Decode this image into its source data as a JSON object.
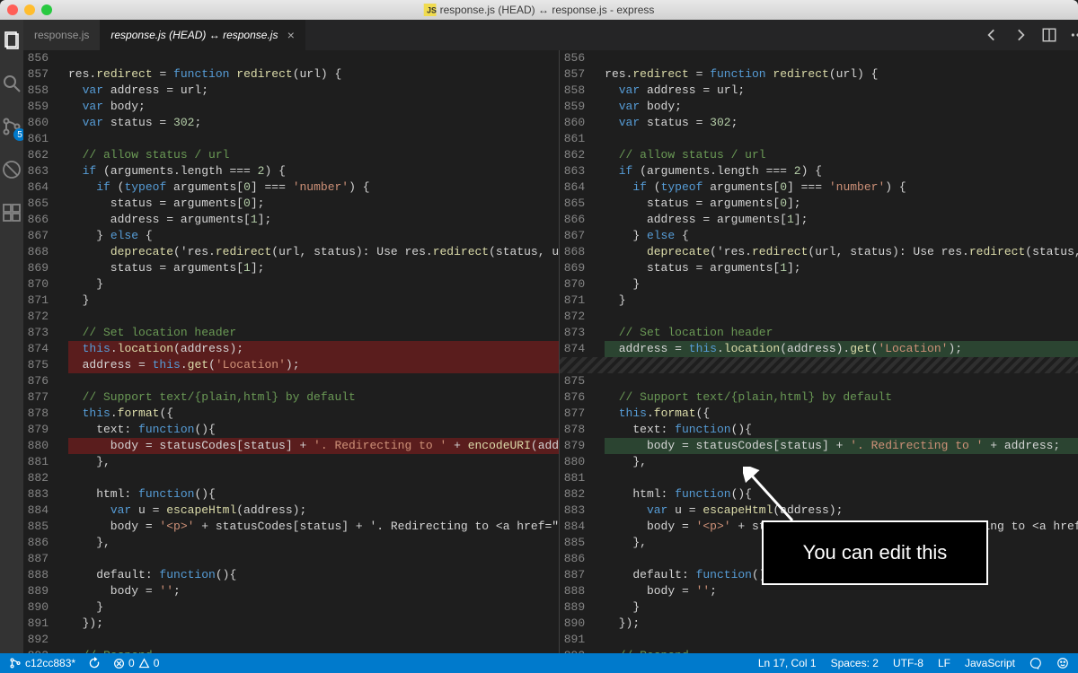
{
  "window": {
    "title": "response.js (HEAD) ↔ response.js - express"
  },
  "activity_bar": {
    "scm_badge": "5"
  },
  "tabs": [
    {
      "label": "response.js",
      "active": false
    },
    {
      "label": "response.js (HEAD) ↔ response.js",
      "active": true
    }
  ],
  "diff": {
    "left_start": 856,
    "right_start": 856,
    "left_lines": [
      {
        "n": 856,
        "t": "",
        "c": ""
      },
      {
        "n": 857,
        "t": "res.redirect = function redirect(url) {",
        "c": ""
      },
      {
        "n": 858,
        "t": "  var address = url;",
        "c": ""
      },
      {
        "n": 859,
        "t": "  var body;",
        "c": ""
      },
      {
        "n": 860,
        "t": "  var status = 302;",
        "c": ""
      },
      {
        "n": 861,
        "t": "",
        "c": ""
      },
      {
        "n": 862,
        "t": "  // allow status / url",
        "c": "cm"
      },
      {
        "n": 863,
        "t": "  if (arguments.length === 2) {",
        "c": ""
      },
      {
        "n": 864,
        "t": "    if (typeof arguments[0] === 'number') {",
        "c": ""
      },
      {
        "n": 865,
        "t": "      status = arguments[0];",
        "c": ""
      },
      {
        "n": 866,
        "t": "      address = arguments[1];",
        "c": ""
      },
      {
        "n": 867,
        "t": "    } else {",
        "c": ""
      },
      {
        "n": 868,
        "t": "      deprecate('res.redirect(url, status): Use res.redirect(status, u",
        "c": ""
      },
      {
        "n": 869,
        "t": "      status = arguments[1];",
        "c": ""
      },
      {
        "n": 870,
        "t": "    }",
        "c": ""
      },
      {
        "n": 871,
        "t": "  }",
        "c": ""
      },
      {
        "n": 872,
        "t": "",
        "c": ""
      },
      {
        "n": 873,
        "t": "  // Set location header",
        "c": "cm"
      },
      {
        "n": 874,
        "t": "  this.location(address);",
        "c": "",
        "m": "del"
      },
      {
        "n": 875,
        "t": "  address = this.get('Location');",
        "c": "",
        "m": "del"
      },
      {
        "n": 876,
        "t": "",
        "c": ""
      },
      {
        "n": 877,
        "t": "  // Support text/{plain,html} by default",
        "c": "cm"
      },
      {
        "n": 878,
        "t": "  this.format({",
        "c": ""
      },
      {
        "n": 879,
        "t": "    text: function(){",
        "c": ""
      },
      {
        "n": 880,
        "t": "      body = statusCodes[status] + '. Redirecting to ' + encodeURI(add",
        "c": "",
        "m": "del"
      },
      {
        "n": 881,
        "t": "    },",
        "c": ""
      },
      {
        "n": 882,
        "t": "",
        "c": ""
      },
      {
        "n": 883,
        "t": "    html: function(){",
        "c": ""
      },
      {
        "n": 884,
        "t": "      var u = escapeHtml(address);",
        "c": ""
      },
      {
        "n": 885,
        "t": "      body = '<p>' + statusCodes[status] + '. Redirecting to <a href=\"",
        "c": ""
      },
      {
        "n": 886,
        "t": "    },",
        "c": ""
      },
      {
        "n": 887,
        "t": "",
        "c": ""
      },
      {
        "n": 888,
        "t": "    default: function(){",
        "c": ""
      },
      {
        "n": 889,
        "t": "      body = '';",
        "c": ""
      },
      {
        "n": 890,
        "t": "    }",
        "c": ""
      },
      {
        "n": 891,
        "t": "  });",
        "c": ""
      },
      {
        "n": 892,
        "t": "",
        "c": ""
      },
      {
        "n": 893,
        "t": "  // Respond",
        "c": "cm"
      }
    ],
    "right_lines": [
      {
        "n": 856,
        "t": "",
        "c": ""
      },
      {
        "n": 857,
        "t": "res.redirect = function redirect(url) {",
        "c": ""
      },
      {
        "n": 858,
        "t": "  var address = url;",
        "c": ""
      },
      {
        "n": 859,
        "t": "  var body;",
        "c": ""
      },
      {
        "n": 860,
        "t": "  var status = 302;",
        "c": ""
      },
      {
        "n": 861,
        "t": "",
        "c": ""
      },
      {
        "n": 862,
        "t": "  // allow status / url",
        "c": "cm"
      },
      {
        "n": 863,
        "t": "  if (arguments.length === 2) {",
        "c": ""
      },
      {
        "n": 864,
        "t": "    if (typeof arguments[0] === 'number') {",
        "c": ""
      },
      {
        "n": 865,
        "t": "      status = arguments[0];",
        "c": ""
      },
      {
        "n": 866,
        "t": "      address = arguments[1];",
        "c": ""
      },
      {
        "n": 867,
        "t": "    } else {",
        "c": ""
      },
      {
        "n": 868,
        "t": "      deprecate('res.redirect(url, status): Use res.redirect(status, u",
        "c": ""
      },
      {
        "n": 869,
        "t": "      status = arguments[1];",
        "c": ""
      },
      {
        "n": 870,
        "t": "    }",
        "c": ""
      },
      {
        "n": 871,
        "t": "  }",
        "c": ""
      },
      {
        "n": 872,
        "t": "",
        "c": ""
      },
      {
        "n": 873,
        "t": "  // Set location header",
        "c": "cm"
      },
      {
        "n": 874,
        "t": "  address = this.location(address).get('Location');",
        "c": "",
        "m": "add"
      },
      {
        "n": "",
        "t": "",
        "c": "",
        "m": "hatch"
      },
      {
        "n": 875,
        "t": "",
        "c": ""
      },
      {
        "n": 876,
        "t": "  // Support text/{plain,html} by default",
        "c": "cm"
      },
      {
        "n": 877,
        "t": "  this.format({",
        "c": ""
      },
      {
        "n": 878,
        "t": "    text: function(){",
        "c": ""
      },
      {
        "n": 879,
        "t": "      body = statusCodes[status] + '. Redirecting to ' + address;",
        "c": "",
        "m": "add"
      },
      {
        "n": 880,
        "t": "    },",
        "c": ""
      },
      {
        "n": 881,
        "t": "",
        "c": ""
      },
      {
        "n": 882,
        "t": "    html: function(){",
        "c": ""
      },
      {
        "n": 883,
        "t": "      var u = escapeHtml(address);",
        "c": ""
      },
      {
        "n": 884,
        "t": "      body = '<p>' + statusCodes[status] + '. Redirecting to <a href=\"",
        "c": ""
      },
      {
        "n": 885,
        "t": "    },",
        "c": ""
      },
      {
        "n": 886,
        "t": "",
        "c": ""
      },
      {
        "n": 887,
        "t": "    default: function(){",
        "c": ""
      },
      {
        "n": 888,
        "t": "      body = '';",
        "c": ""
      },
      {
        "n": 889,
        "t": "    }",
        "c": ""
      },
      {
        "n": 890,
        "t": "  });",
        "c": ""
      },
      {
        "n": 891,
        "t": "",
        "c": ""
      },
      {
        "n": 892,
        "t": "  // Respond",
        "c": "cm"
      }
    ]
  },
  "statusbar": {
    "branch": "c12cc883*",
    "errors": "0",
    "warnings": "0",
    "position": "Ln 17, Col 1",
    "spaces": "Spaces: 2",
    "encoding": "UTF-8",
    "eol": "LF",
    "lang": "JavaScript"
  },
  "callout": "You can edit this"
}
